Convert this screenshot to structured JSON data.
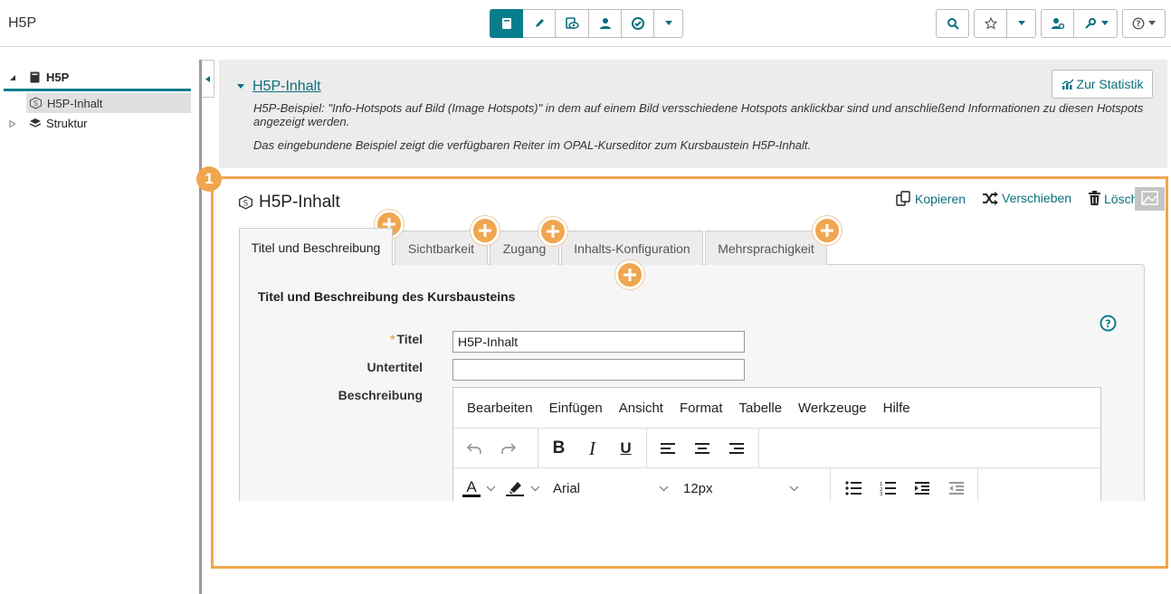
{
  "app": {
    "title": "H5P"
  },
  "tree": {
    "root": "H5P",
    "child": "H5P-Inhalt",
    "sibling": "Struktur"
  },
  "info": {
    "title": "H5P-Inhalt",
    "line1": "H5P-Beispiel: \"Info-Hotspots auf Bild (Image Hotspots)\"  in dem auf einem Bild versschiedene Hotspots anklickbar sind und anschließend Informationen zu diesen Hotspots angezeigt werden.",
    "line2": "Das eingebundene Beispiel zeigt die verfügbaren Reiter im OPAL-Kurseditor zum Kursbaustein H5P-Inhalt.",
    "stat_button": "Zur Statistik"
  },
  "badge": "1",
  "node": {
    "title": "H5P-Inhalt",
    "copy": "Kopieren",
    "move": "Verschieben",
    "delete": "Löschen"
  },
  "tabs": [
    {
      "label": "Titel und Beschreibung"
    },
    {
      "label": "Sichtbarkeit"
    },
    {
      "label": "Zugang"
    },
    {
      "label": "Inhalts-Konfiguration"
    },
    {
      "label": "Mehrsprachigkeit"
    }
  ],
  "form": {
    "section_title": "Titel und Beschreibung des Kursbausteins",
    "required_mark": "*",
    "title_label": "Titel",
    "title_value": "H5P-Inhalt",
    "subtitle_label": "Untertitel",
    "subtitle_value": "",
    "description_label": "Beschreibung"
  },
  "editor": {
    "menu": [
      "Bearbeiten",
      "Einfügen",
      "Ansicht",
      "Format",
      "Tabelle",
      "Werkzeuge",
      "Hilfe"
    ],
    "font": "Arial",
    "size": "12px",
    "bold": "B",
    "italic": "I",
    "underline": "U",
    "text_color_glyph": "A"
  },
  "colors": {
    "accent": "#0a7d8c",
    "highlight": "#f0a64f"
  }
}
